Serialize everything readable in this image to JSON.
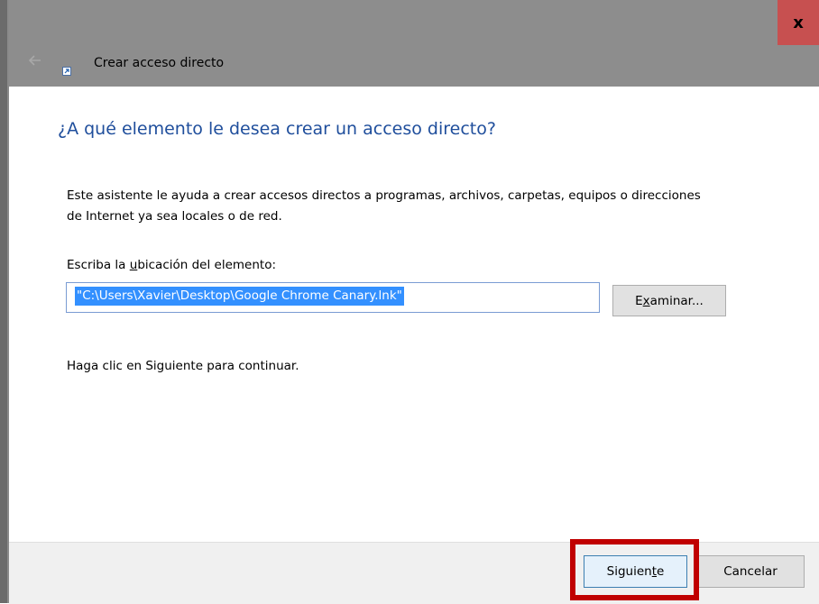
{
  "window": {
    "title": "Crear acceso directo",
    "close_label": "x"
  },
  "main": {
    "heading": "¿A qué elemento le desea crear un acceso directo?",
    "description_line1": "Este asistente le ayuda a crear accesos directos a programas, archivos, carpetas, equipos o direcciones",
    "description_line2": "de Internet ya sea locales o de red.",
    "location_label_pre": "Escriba la ",
    "location_label_ul": "u",
    "location_label_post": "bicación del elemento:",
    "location_value": "\"C:\\Users\\Xavier\\Desktop\\Google Chrome Canary.lnk\"",
    "browse_pre": "E",
    "browse_ul": "x",
    "browse_post": "aminar...",
    "continue_text": "Haga clic en Siguiente para continuar."
  },
  "footer": {
    "next_pre": "Siguien",
    "next_ul": "t",
    "next_post": "e",
    "cancel_label": "Cancelar"
  },
  "icons": {
    "back": "back-arrow-icon",
    "wizard": "shortcut-wizard-icon",
    "close": "close-icon"
  },
  "colors": {
    "heading": "#1f4e9c",
    "close_button": "#c75050",
    "selection": "#3390ff",
    "highlight": "#c00000"
  }
}
